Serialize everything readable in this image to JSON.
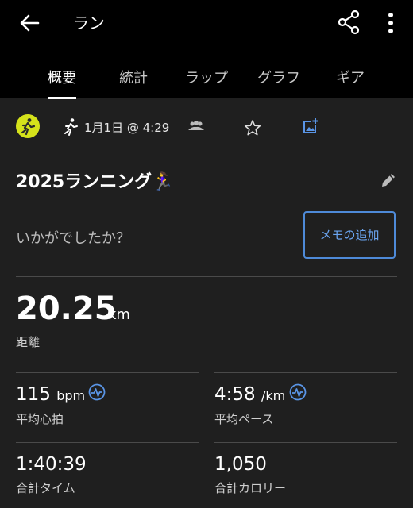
{
  "header": {
    "title": "ラン"
  },
  "tabs": [
    {
      "label": "概要"
    },
    {
      "label": "統計"
    },
    {
      "label": "ラップ"
    },
    {
      "label": "グラフ"
    },
    {
      "label": "ギア"
    }
  ],
  "activity": {
    "datetime": "1月1日 @ 4:29",
    "name": "2025ランニング🏃‍♀️",
    "question": "いかがでしたか？",
    "memo_button": "メモの追加"
  },
  "distance": {
    "value": "20.25",
    "unit": "km",
    "label": "距離"
  },
  "stats": [
    {
      "value": "115",
      "unit": "bpm",
      "label": "平均心拍"
    },
    {
      "value": "4:58",
      "unit": "/km",
      "label": "平均ペース"
    },
    {
      "value": "1:40:39",
      "unit": "",
      "label": "合計タイム"
    },
    {
      "value": "1,050",
      "unit": "",
      "label": "合計カロリー"
    }
  ],
  "colors": {
    "accent": "#4e8ad8",
    "badge": "#d5e21b",
    "topbar": "#000000",
    "background": "#1f1f1f"
  },
  "icons": [
    "back-arrow-icon",
    "share-icon",
    "more-vert-icon",
    "run-badge-icon",
    "runner-icon",
    "people-icon",
    "star-icon",
    "add-photo-icon",
    "pencil-icon",
    "heart-rate-icon"
  ]
}
